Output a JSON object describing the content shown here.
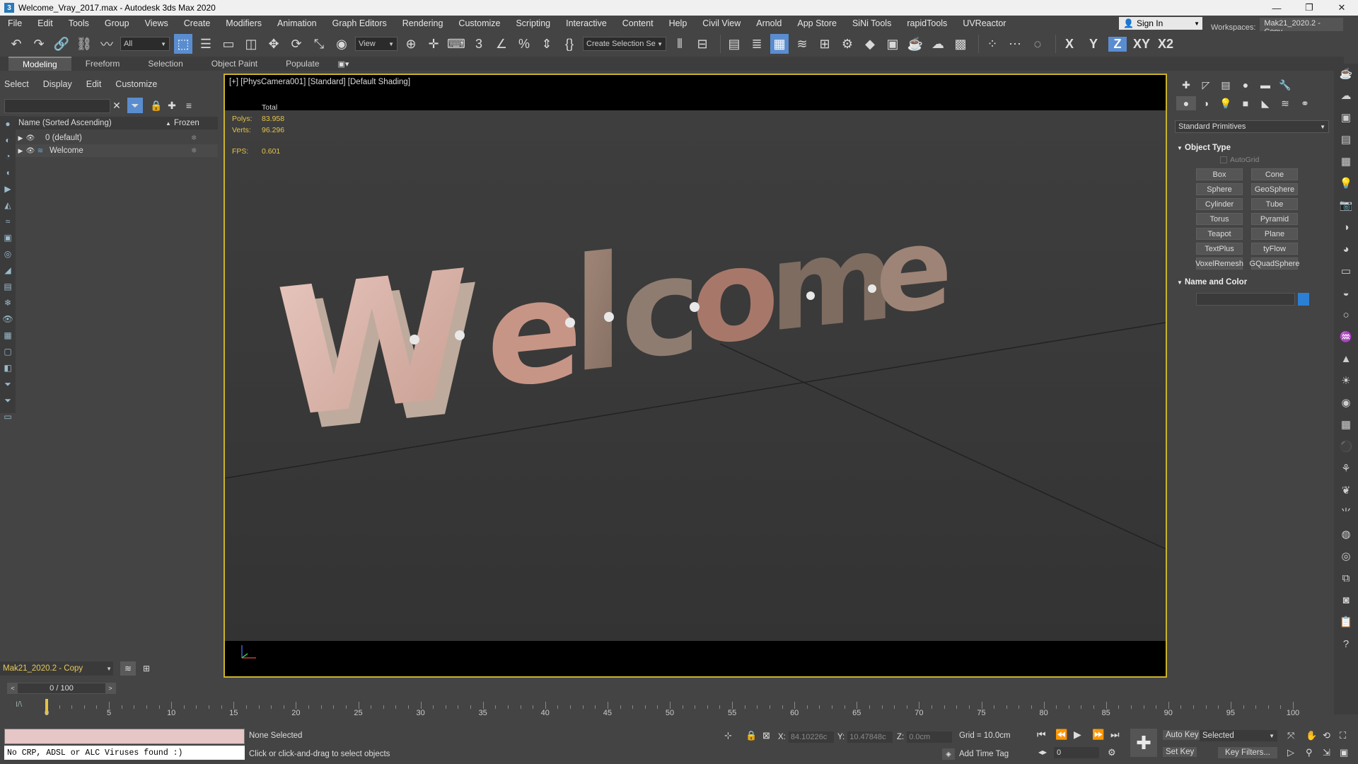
{
  "window": {
    "title": "Welcome_Vray_2017.max - Autodesk 3ds Max 2020",
    "app_icon": "3"
  },
  "menu": [
    "File",
    "Edit",
    "Tools",
    "Group",
    "Views",
    "Create",
    "Modifiers",
    "Animation",
    "Graph Editors",
    "Rendering",
    "Customize",
    "Scripting",
    "Interactive",
    "Content",
    "Help",
    "Civil View",
    "Arnold",
    "App Store",
    "SiNi Tools",
    "rapidTools",
    "UVReactor"
  ],
  "account": {
    "sign_in": "Sign In",
    "workspaces_label": "Workspaces:",
    "workspace": "Mak21_2020.2 - Copy"
  },
  "toolbar": {
    "filter": "All",
    "ref_coord": "View",
    "selection_set": "Create Selection Se"
  },
  "axes": {
    "x": "X",
    "y": "Y",
    "z": "Z",
    "xy": "XY",
    "xz": "X2"
  },
  "ribbon_tabs": [
    "Modeling",
    "Freeform",
    "Selection",
    "Object Paint",
    "Populate"
  ],
  "scene_explorer": {
    "menu": [
      "Select",
      "Display",
      "Edit",
      "Customize"
    ],
    "col_name": "Name (Sorted Ascending)",
    "col_frozen": "Frozen",
    "sort_arrow": "▲",
    "rows": [
      {
        "name": "0 (default)"
      },
      {
        "name": "Welcome"
      }
    ],
    "workspace": "Mak21_2020.2 - Copy"
  },
  "viewport": {
    "label": "[+] [PhysCamera001] [Standard] [Default Shading]",
    "stats_header": "Total",
    "polys_label": "Polys:",
    "polys": "83.958",
    "verts_label": "Verts:",
    "verts": "96.296",
    "fps_label": "FPS:",
    "fps": "0.601",
    "scene_text": "Welcome"
  },
  "command_panel": {
    "category": "Standard Primitives",
    "object_type": "Object Type",
    "autogrid": "AutoGrid",
    "buttons": [
      "Box",
      "Cone",
      "Sphere",
      "GeoSphere",
      "Cylinder",
      "Tube",
      "Torus",
      "Pyramid",
      "Teapot",
      "Plane",
      "TextPlus",
      "tyFlow",
      "VoxelRemesh",
      "GQuadSphere"
    ],
    "name_and_color": "Name and Color",
    "swatch_color": "#2b7fd4"
  },
  "timeline": {
    "frame": "0 / 100",
    "ticks": [
      "0",
      "5",
      "10",
      "15",
      "20",
      "25",
      "30",
      "35",
      "40",
      "45",
      "50",
      "55",
      "60",
      "65",
      "70",
      "75",
      "80",
      "85",
      "90",
      "95",
      "100"
    ]
  },
  "status": {
    "maxscript": "No CRP, ADSL or ALC Viruses found :)",
    "selection": "None Selected",
    "prompt": "Click or click-and-drag to select objects",
    "x_label": "X:",
    "x": "84.10226c",
    "y_label": "Y:",
    "y": "10.47848c",
    "z_label": "Z:",
    "z": "0.0cm",
    "grid": "Grid = 10.0cm",
    "add_time_tag": "Add Time Tag",
    "auto_key": "Auto Key",
    "set_key": "Set Key",
    "key_mode": "Selected",
    "key_filters": "Key Filters...",
    "current_frame": "0"
  }
}
